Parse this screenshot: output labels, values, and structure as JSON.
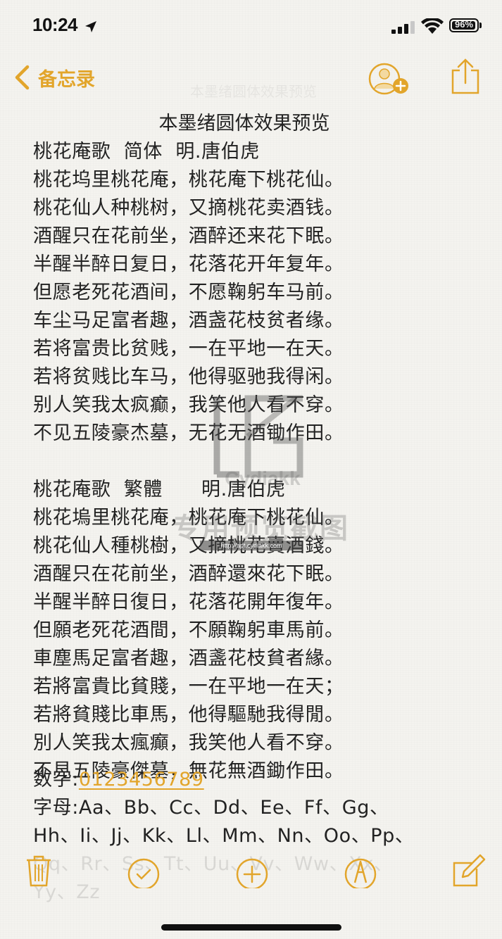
{
  "status_bar": {
    "time": "10:24",
    "battery_level": "96%",
    "battery_fraction": 0.96
  },
  "nav": {
    "back_label": "备忘录",
    "faded_title": "本墨绪圆体效果预览"
  },
  "note": {
    "title": "本墨绪圆体效果预览",
    "lines": [
      "桃花庵歌  简体  明.唐伯虎",
      "桃花坞里桃花庵，桃花庵下桃花仙。",
      "桃花仙人种桃树，又摘桃花卖酒钱。",
      "酒醒只在花前坐，酒醉还来花下眠。",
      "半醒半醉日复日，花落花开年复年。",
      "但愿老死花酒间，不愿鞠躬车马前。",
      "车尘马足富者趣，酒盏花枝贫者缘。",
      "若将富贵比贫贱，一在平地一在天。",
      "若将贫贱比车马，他得驱驰我得闲。",
      "别人笑我太疯癫，我笑他人看不穿。",
      "不见五陵豪杰墓，无花无酒锄作田。",
      "",
      "桃花庵歌  繁體      明.唐伯虎",
      "桃花塢里桃花庵，桃花庵下桃花仙。",
      "桃花仙人種桃樹，又摘桃花賣酒錢。",
      "酒醒只在花前坐，酒醉還來花下眠。",
      "半醒半醉日復日，花落花開年復年。",
      "但願老死花酒間，不願鞠躬車馬前。",
      "車塵馬足富者趣，酒盞花枝貧者緣。",
      "若將富貴比貧賤，一在平地一在天；",
      "若將貧賤比車馬，他得驅馳我得閒。",
      "別人笑我太瘋癲，我笑他人看不穿。",
      "不見五陵豪傑墓，無花無酒鋤作田。",
      ""
    ],
    "digits_label": "数字:",
    "digits_value": "0123456789",
    "letters_line1": "字母:Aa、Bb、Cc、Dd、Ee、Ff、Gg、",
    "letters_line2": "Hh、Ii、Jj、Kk、Ll、Mm、Nn、Oo、Pp、",
    "letters_line3": "Qq、Rr、Ss、Tt、Uu、Vv、Ww、Xx、",
    "letters_line4": "Yy、Zz"
  },
  "watermark": {
    "brand": "Cydiakk",
    "text": "专用预览截图",
    "url": "http://apt.cydiakk.com"
  },
  "toolbar": {
    "icons": [
      "trash-icon",
      "checklist-icon",
      "add-icon",
      "markup-icon",
      "compose-icon"
    ]
  },
  "colors": {
    "accent": "#e2a52b",
    "text": "#222222",
    "background": "#f4f3ef"
  }
}
